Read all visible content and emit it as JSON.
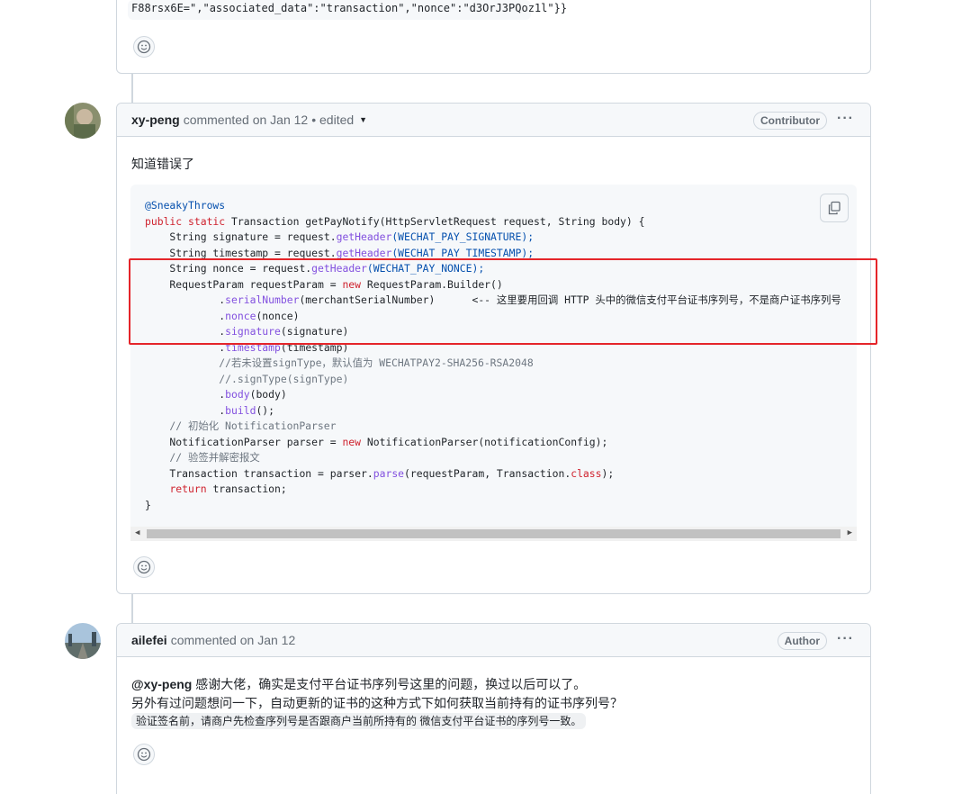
{
  "top_comment": {
    "code_tail": "F88rsx6E=\",\"associated_data\":\"transaction\",\"nonce\":\"d3OrJ3PQoz1l\"}}"
  },
  "comment1": {
    "author": "xy-peng",
    "meta": "commented on Jan 12",
    "edited": "• edited",
    "badge": "Contributor",
    "menu": "···",
    "body": "知道错误了",
    "code": {
      "l1": "@SneakyThrows",
      "l2a": "public static",
      "l2b": " Transaction getPayNotify(HttpServletRequest request, String body) {",
      "l3a": "    String signature = request.",
      "l3b": "getHeader",
      "l3c": "(WECHAT_PAY_SIGNATURE);",
      "l4a": "    String timestamp = request.",
      "l4b": "getHeader",
      "l4c": "(WECHAT_PAY_TIMESTAMP);",
      "l5a": "    String nonce = request.",
      "l5b": "getHeader",
      "l5c": "(WECHAT_PAY_NONCE);",
      "l6a": "    RequestParam requestParam = ",
      "l6b": "new",
      "l6c": " RequestParam.Builder()",
      "l7a": "            .",
      "l7b": "serialNumber",
      "l7c": "(merchantSerialNumber)      <-- 这里要用回调 HTTP 头中的微信支付平台证书序列号，不是商户证书序列号",
      "l8a": "            .",
      "l8b": "nonce",
      "l8c": "(nonce)",
      "l9a": "            .",
      "l9b": "signature",
      "l9c": "(signature)",
      "l10a": "            .",
      "l10b": "timestamp",
      "l10c": "(timestamp)",
      "l11": "            //若未设置signType，默认值为 WECHATPAY2-SHA256-RSA2048",
      "l12": "            //.signType(signType)",
      "l13a": "            .",
      "l13b": "body",
      "l13c": "(body)",
      "l14a": "            .",
      "l14b": "build",
      "l14c": "();",
      "l15": "    // 初始化 NotificationParser",
      "l16a": "    NotificationParser parser = ",
      "l16b": "new",
      "l16c": " NotificationParser(notificationConfig);",
      "l17": "    // 验签并解密报文",
      "l18a": "    Transaction transaction = parser.",
      "l18b": "parse",
      "l18c": "(requestParam, Transaction.",
      "l18d": "class",
      "l18e": ");",
      "l19a": "    ",
      "l19b": "return",
      "l19c": " transaction;",
      "l20": "}"
    }
  },
  "comment2": {
    "author": "ailefei",
    "meta": "commented on Jan 12",
    "badge": "Author",
    "menu": "···",
    "mention": "@xy-peng",
    "line1": " 感谢大佬，确实是支付平台证书序列号这里的问题，换过以后可以了。",
    "line2": "另外有过问题想问一下，自动更新的证书的这种方式下如何获取当前持有的证书序列号？",
    "line3": "验证签名前，请商户先检查序列号是否跟商户当前所持有的 微信支付平台证书的序列号一致。"
  },
  "colors": {
    "border": "#d0d7de",
    "header_bg": "#f6f8fa",
    "highlight": "#e5252a",
    "keyword": "#cf222e",
    "function": "#8250df"
  }
}
